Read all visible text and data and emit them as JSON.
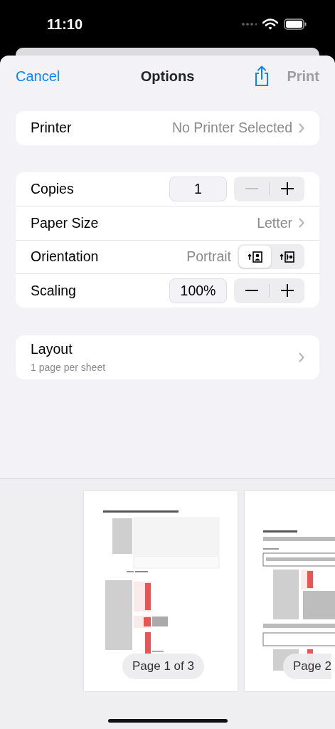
{
  "status_bar": {
    "time": "11:10"
  },
  "nav": {
    "cancel": "Cancel",
    "title": "Options",
    "print": {
      "label": "Print",
      "disabled": true
    }
  },
  "printer": {
    "label": "Printer",
    "value": "No Printer Selected"
  },
  "options": [
    {
      "kind": "stepper",
      "label": "Copies",
      "value": "1",
      "minus_disabled": true
    },
    {
      "kind": "link",
      "label": "Paper Size",
      "value": "Letter"
    },
    {
      "kind": "orientation",
      "label": "Orientation",
      "value": "Portrait",
      "choices": [
        {
          "selected": true
        },
        {
          "selected": false
        }
      ]
    },
    {
      "kind": "stepper",
      "label": "Scaling",
      "value": "100%",
      "minus_disabled": false
    }
  ],
  "layout": {
    "label": "Layout",
    "detail": "1 page per sheet"
  },
  "pages": [
    {
      "kind": "picture",
      "badge": "Page 1 of 3"
    },
    {
      "kind": "picture",
      "badge": "Page 2"
    }
  ]
}
